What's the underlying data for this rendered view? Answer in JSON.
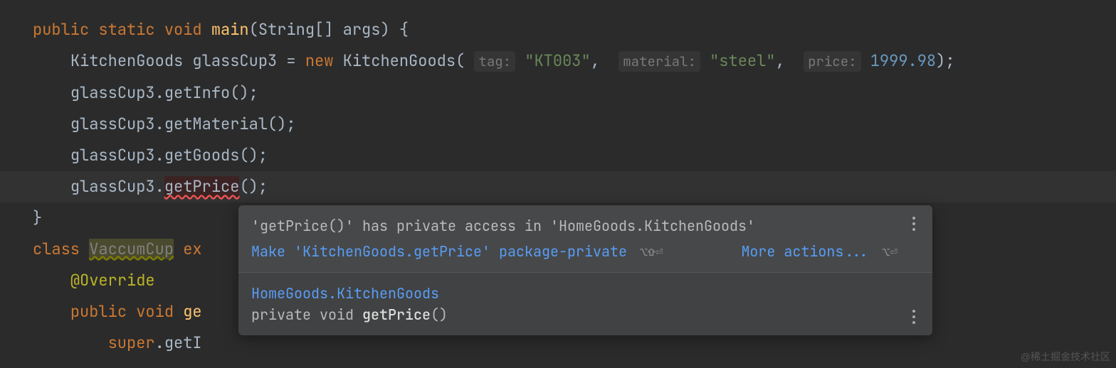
{
  "code": {
    "l1": {
      "kw1": "public",
      "kw2": "static",
      "kw3": "void",
      "fn": "main",
      "args": "(String[] args) {"
    },
    "l2": {
      "cls": "KitchenGoods",
      "var": "glassCup3 = ",
      "kw": "new",
      "ctor": "KitchenGoods",
      "p1h": "tag:",
      "p1v": "\"KT003\"",
      "c1": ",  ",
      "p2h": "material:",
      "p2v": "\"steel\"",
      "c2": ",  ",
      "p3h": "price:",
      "p3v": "1999.98",
      "end": ");"
    },
    "l3": {
      "txt": "glassCup3.getInfo();"
    },
    "l4": {
      "txt": "glassCup3.getMaterial();"
    },
    "l5": {
      "txt": "glassCup3.getGoods();"
    },
    "l6": {
      "pre": "glassCup3.",
      "err": "getPrice",
      "post": "();"
    },
    "l7": {
      "txt": "}"
    },
    "l8": {
      "kw": "class",
      "name": "VaccumCup",
      "ext": "ex"
    },
    "l9": {
      "ann": "@Override"
    },
    "l10": {
      "kw1": "public",
      "kw2": "void",
      "fn": "ge"
    },
    "l11": {
      "kw": "super",
      "post": ".getI"
    }
  },
  "popup": {
    "message": "'getPrice()' has private access in 'HomeGoods.KitchenGoods'",
    "fix": "Make 'KitchenGoods.getPrice' package-private",
    "fixShortcut": "⌥⇧⏎",
    "more": "More actions...",
    "moreShortcut": "⌥⏎",
    "sigClass": "HomeGoods.KitchenGoods",
    "sigMods": "private void ",
    "sigFn": "getPrice",
    "sigParams": "()"
  },
  "watermark": "@稀土掘金技术社区"
}
